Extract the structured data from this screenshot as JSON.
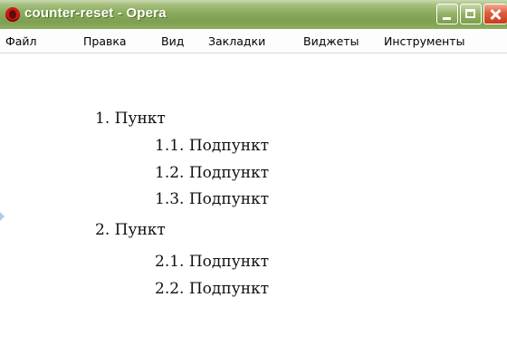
{
  "window": {
    "title": "counter-reset - Opera",
    "icon": "opera-logo-icon"
  },
  "menubar": {
    "items": [
      {
        "label": "Файл"
      },
      {
        "label": "Правка"
      },
      {
        "label": "Вид"
      },
      {
        "label": "Закладки"
      },
      {
        "label": "Виджеты"
      },
      {
        "label": "Инструменты"
      }
    ]
  },
  "content": {
    "list": [
      {
        "marker": "1.",
        "text": "Пункт"
      },
      {
        "marker": "1.1.",
        "text": "Подпункт"
      },
      {
        "marker": "1.2.",
        "text": "Подпункт"
      },
      {
        "marker": "1.3.",
        "text": "Подпункт"
      },
      {
        "marker": "2.",
        "text": "Пункт"
      },
      {
        "marker": "2.1.",
        "text": "Подпункт"
      },
      {
        "marker": "2.2.",
        "text": "Подпункт"
      }
    ]
  }
}
